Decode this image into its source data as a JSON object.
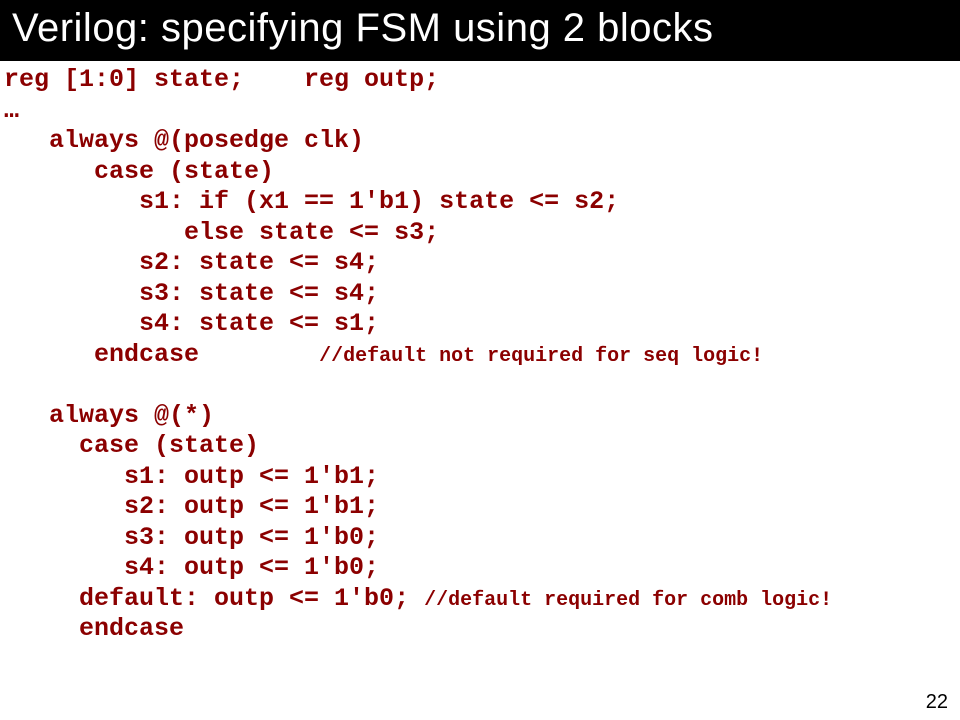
{
  "title": "Verilog:  specifying FSM using 2 blocks",
  "pagenum": "22",
  "code": {
    "l1": "reg [1:0] state;    reg outp;",
    "l2": "…",
    "l3": "   always @(posedge clk)",
    "l4": "      case (state)",
    "l5": "         s1: if (x1 == 1'b1) state <= s2;",
    "l6": "            else state <= s3;",
    "l7": "         s2: state <= s4;",
    "l8": "         s3: state <= s4;",
    "l9": "         s4: state <= s1;",
    "l10": "      endcase        ",
    "c10": "//default not required for seq logic!",
    "l11": "",
    "l12": "   always @(*)",
    "l13": "     case (state)",
    "l14": "        s1: outp <= 1'b1;",
    "l15": "        s2: outp <= 1'b1;",
    "l16": "        s3: outp <= 1'b0;",
    "l17": "        s4: outp <= 1'b0;",
    "l18": "     default: outp <= 1'b0; ",
    "c18": "//default required for comb logic!",
    "l19": "     endcase"
  }
}
